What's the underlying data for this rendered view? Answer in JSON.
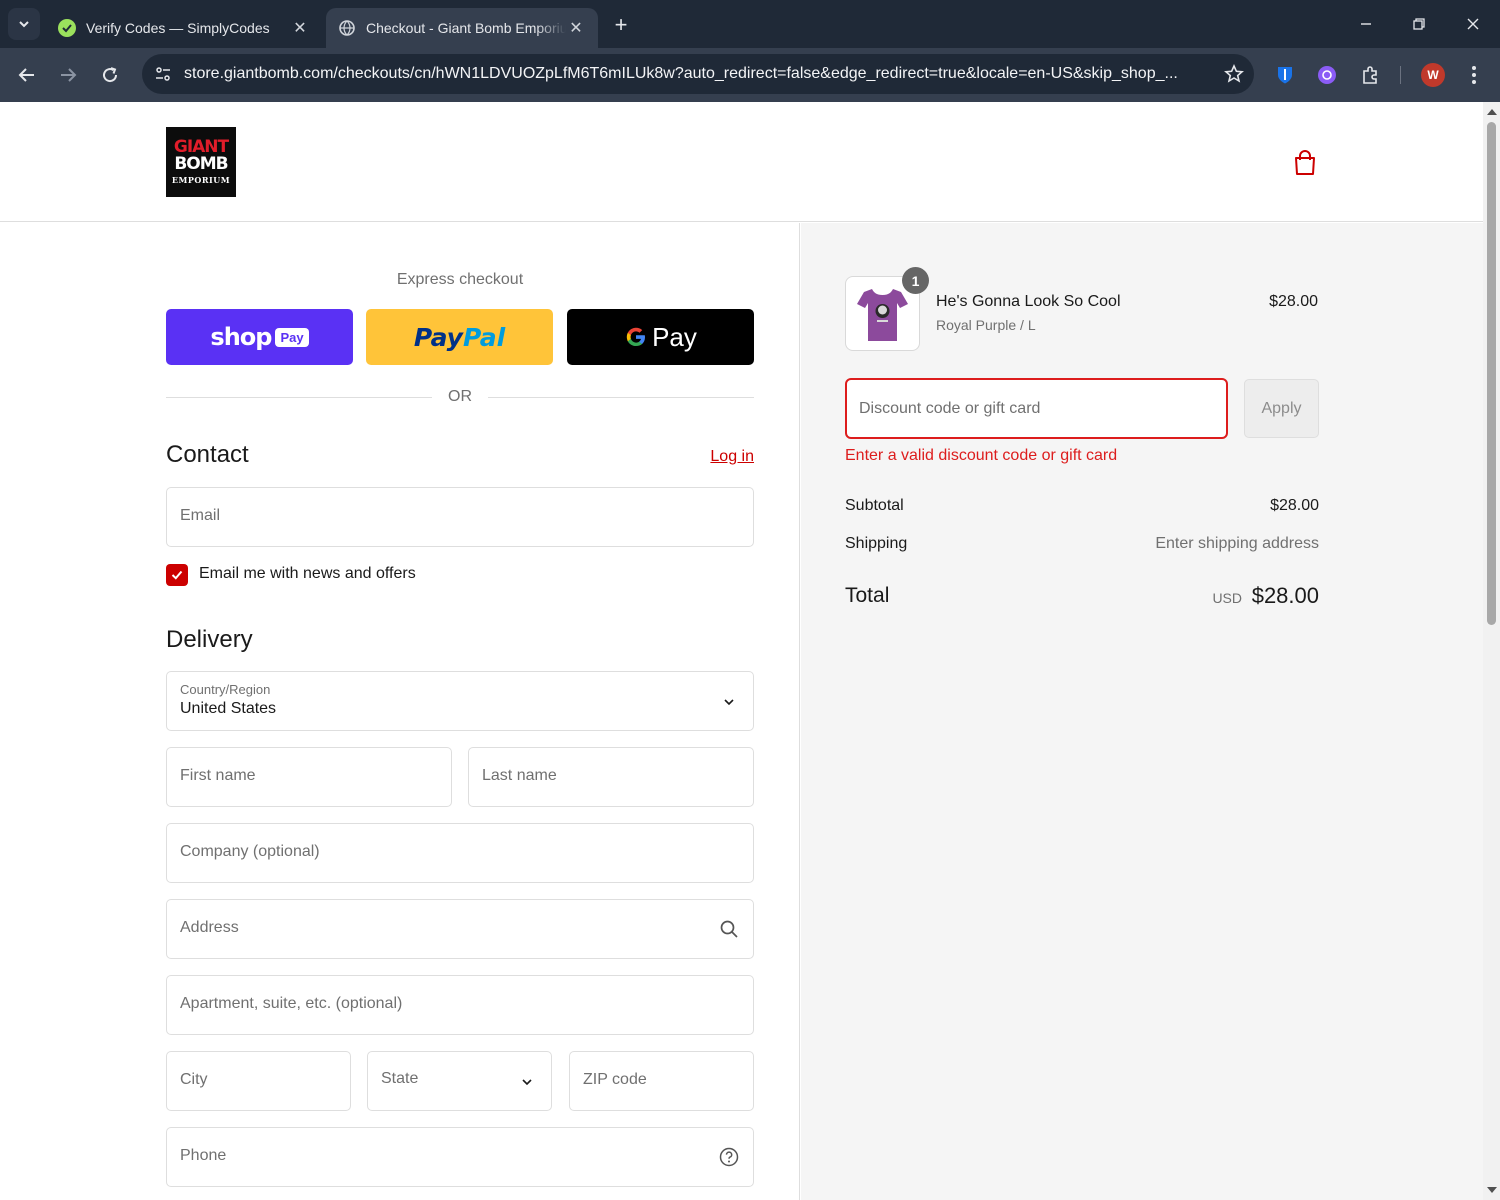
{
  "browser": {
    "tabs": [
      {
        "title": "Verify Codes — SimplyCodes",
        "close": "✕"
      },
      {
        "title": "Checkout - Giant Bomb Emporium",
        "close": "✕"
      }
    ],
    "new_tab": "+",
    "url": "store.giantbomb.com/checkouts/cn/hWN1LDVUOZpLfM6T6mILUk8w?auto_redirect=false&edge_redirect=true&locale=en-US&skip_shop_...",
    "profile_initial": "W",
    "colors": {
      "frame": "#1f2937",
      "toolbar": "#353f4f",
      "profile": "#c0392b"
    }
  },
  "store": {
    "logo": {
      "line1": "GIANT",
      "line2": "BOMB",
      "line3": "EMPORIUM"
    },
    "accent_color": "#cc0000"
  },
  "express": {
    "label": "Express checkout",
    "shop_word": "shop",
    "shop_pay": "Pay",
    "paypal_1": "Pay",
    "paypal_2": "Pal",
    "gpay_word": "Pay",
    "or": "OR"
  },
  "contact": {
    "title": "Contact",
    "login": "Log in",
    "email_placeholder": "Email",
    "newsletter_label": "Email me with news and offers",
    "newsletter_checked": true
  },
  "delivery": {
    "title": "Delivery",
    "country_label": "Country/Region",
    "country_value": "United States",
    "first_name": "First name",
    "last_name": "Last name",
    "company": "Company (optional)",
    "address": "Address",
    "apartment": "Apartment, suite, etc. (optional)",
    "city": "City",
    "state": "State",
    "zip": "ZIP code",
    "phone": "Phone"
  },
  "summary": {
    "item": {
      "quantity": "1",
      "name": "He's Gonna Look So Cool",
      "variant": "Royal Purple / L",
      "price": "$28.00"
    },
    "discount_placeholder": "Discount code or gift card",
    "apply": "Apply",
    "discount_error": "Enter a valid discount code or gift card",
    "subtotal_label": "Subtotal",
    "subtotal_value": "$28.00",
    "shipping_label": "Shipping",
    "shipping_value": "Enter shipping address",
    "total_label": "Total",
    "currency": "USD",
    "total_value": "$28.00"
  }
}
